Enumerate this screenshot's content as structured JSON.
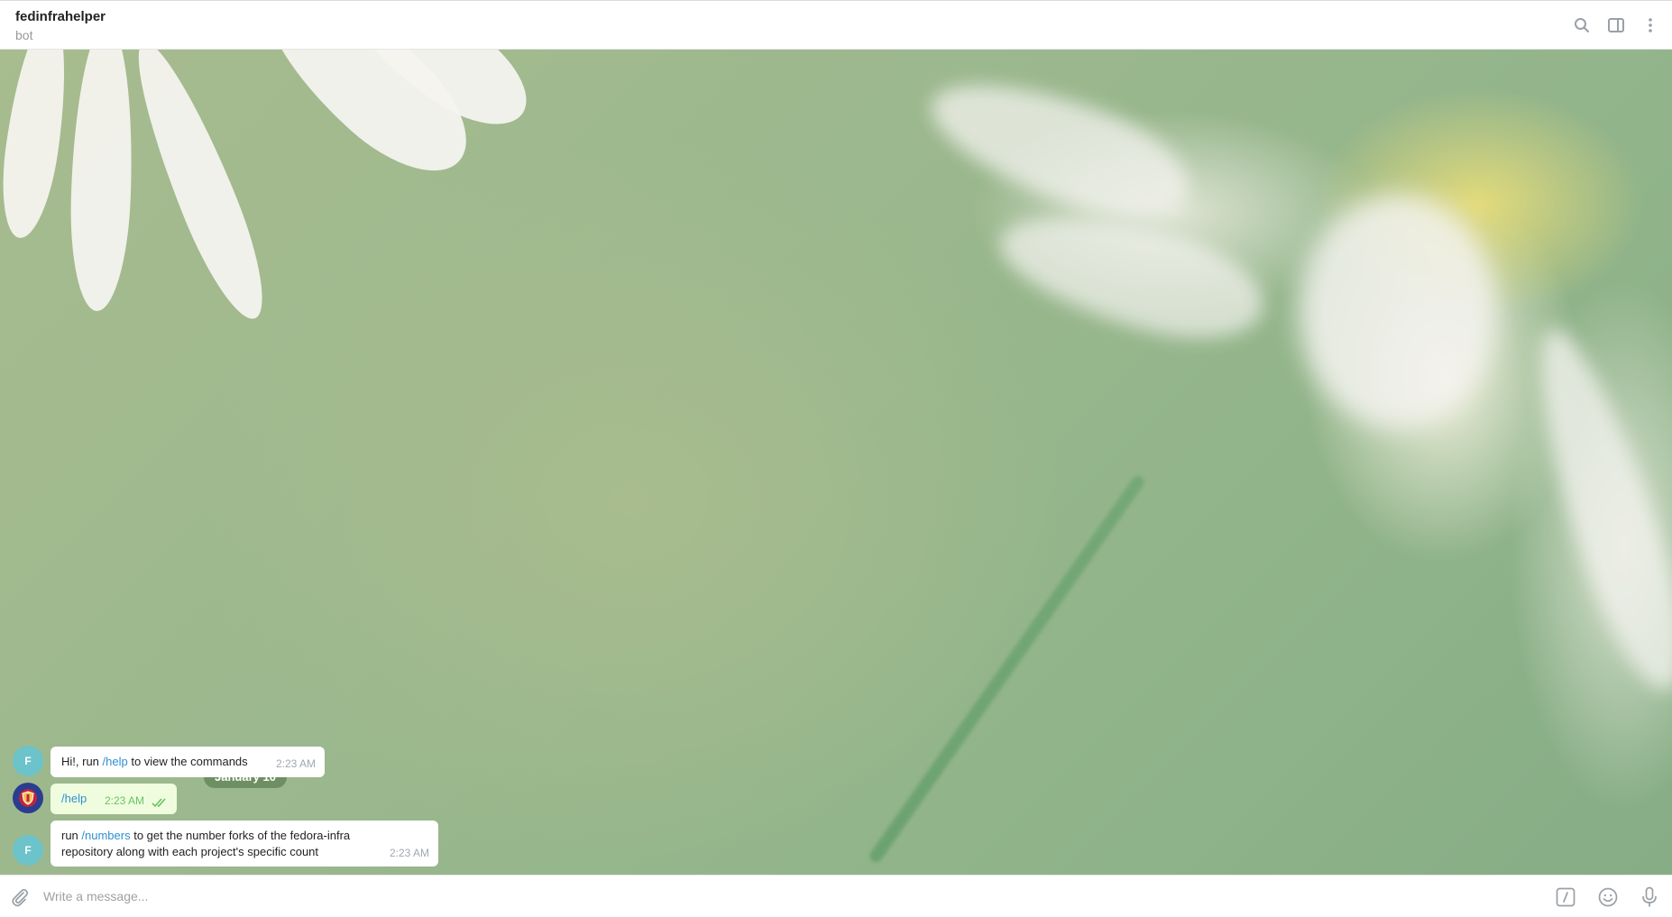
{
  "header": {
    "title": "fedinfrahelper",
    "subtitle": "bot",
    "icons": [
      "search-icon",
      "sidebar-toggle-icon",
      "more-vertical-icon"
    ]
  },
  "chat": {
    "date_divider": "January 10",
    "messages": [
      {
        "sender": "bot",
        "avatar_letter": "F",
        "text_before": "Hi!, run ",
        "command": "/help",
        "text_after": " to view the commands",
        "time": "2:23 AM"
      },
      {
        "sender": "user",
        "command": "/help",
        "time": "2:23 AM",
        "status": "read"
      },
      {
        "sender": "bot",
        "avatar_letter": "F",
        "text_before": "run ",
        "command": "/numbers",
        "text_after_line1": " to get the number forks of the fedora-infra",
        "text_line2": "repository along with each project's specific count",
        "time": "2:23 AM"
      }
    ]
  },
  "composer": {
    "placeholder": "Write a message...",
    "value": "",
    "icons": [
      "attach-icon",
      "bot-commands-icon",
      "emoji-icon",
      "microphone-icon"
    ]
  },
  "colors": {
    "link": "#2f8fd1",
    "outgoing_bubble": "#effdde",
    "bot_avatar": "#6cc3c9",
    "read_ticks": "#6cc264"
  }
}
